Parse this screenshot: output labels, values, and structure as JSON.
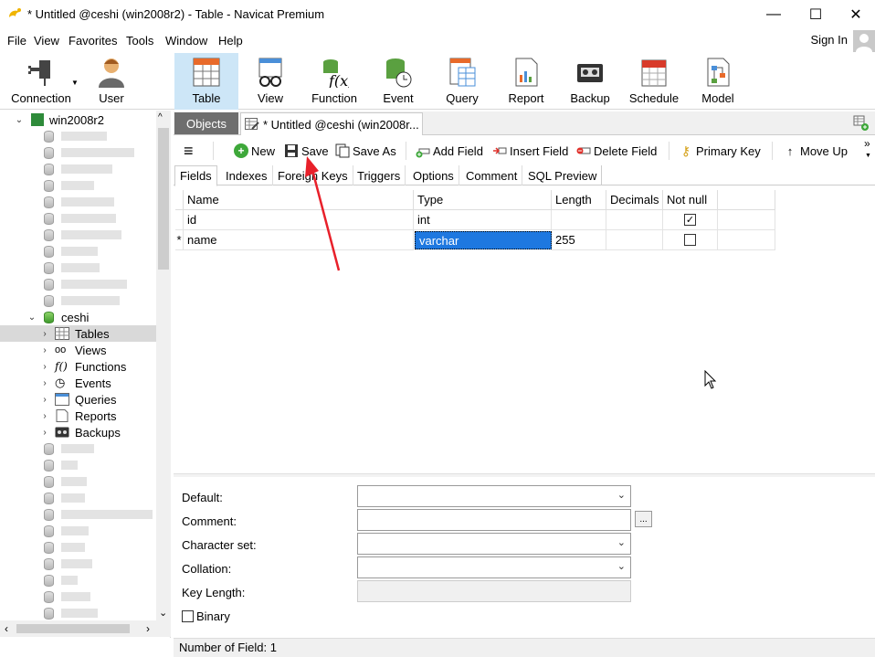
{
  "window": {
    "title": "* Untitled @ceshi (win2008r2) - Table - Navicat Premium",
    "minimize": "—",
    "maximize": "☐",
    "close": "✕"
  },
  "menu": {
    "items": [
      "File",
      "View",
      "Favorites",
      "Tools",
      "Window",
      "Help"
    ],
    "sign_in": "Sign In"
  },
  "ribbon": {
    "items": [
      "Connection",
      "User",
      "Table",
      "View",
      "Function",
      "Event",
      "Query",
      "Report",
      "Backup",
      "Schedule",
      "Model"
    ]
  },
  "tree": {
    "connection": "win2008r2",
    "database": "ceshi",
    "children": [
      "Tables",
      "Views",
      "Functions",
      "Events",
      "Queries",
      "Reports",
      "Backups"
    ]
  },
  "tabs": {
    "objects": "Objects",
    "current": "* Untitled @ceshi (win2008r..."
  },
  "toolbar": {
    "menu": "≡",
    "new": "New",
    "save": "Save",
    "save_as": "Save As",
    "add_field": "Add Field",
    "insert_field": "Insert Field",
    "delete_field": "Delete Field",
    "primary_key": "Primary Key",
    "move_up": "Move Up",
    "more": "»"
  },
  "subtabs": [
    "Fields",
    "Indexes",
    "Foreign Keys",
    "Triggers",
    "Options",
    "Comment",
    "SQL Preview"
  ],
  "grid": {
    "headers": [
      "Name",
      "Type",
      "Length",
      "Decimals",
      "Not null"
    ],
    "rows": [
      {
        "marker": "",
        "name": "id",
        "type": "int",
        "length": "",
        "decimals": "",
        "not_null": true
      },
      {
        "marker": "*",
        "name": "name",
        "type": "varchar",
        "length": "255",
        "decimals": "",
        "not_null": false
      }
    ]
  },
  "properties": {
    "default": "Default:",
    "comment": "Comment:",
    "charset": "Character set:",
    "collation": "Collation:",
    "key_length": "Key Length:",
    "binary": "Binary",
    "ellipsis": "..."
  },
  "status": {
    "text": "Number of Field: 1"
  },
  "colors": {
    "selection": "#1e78e0",
    "ribbon_active": "#cde6f7",
    "arrow": "#e8202a"
  }
}
